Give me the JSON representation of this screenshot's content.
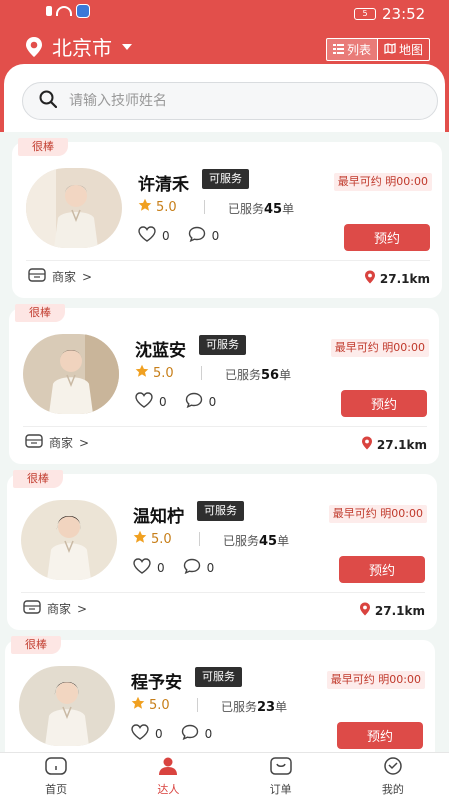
{
  "status_bar": {
    "time": "23:52",
    "battery": "5"
  },
  "header": {
    "city": "北京市",
    "view_list": "列表",
    "view_map": "地图"
  },
  "search": {
    "placeholder": "请输入技师姓名"
  },
  "labels": {
    "badge_good": "很棒",
    "service_status": "可服务",
    "earliest_prefix": "最早可约",
    "served_prefix": "已服务",
    "served_suffix": "单",
    "book": "预约",
    "merchant": "商家",
    "merchant_arrow": ">"
  },
  "therapists": [
    {
      "name": "许清禾",
      "earliest": "明00:00",
      "rating": "5.0",
      "served": "45",
      "likes": "0",
      "comments": "0",
      "distance": "27.1km"
    },
    {
      "name": "沈蓝安",
      "earliest": "明00:00",
      "rating": "5.0",
      "served": "56",
      "likes": "0",
      "comments": "0",
      "distance": "27.1km"
    },
    {
      "name": "温知柠",
      "earliest": "明00:00",
      "rating": "5.0",
      "served": "45",
      "likes": "0",
      "comments": "0",
      "distance": "27.1km"
    },
    {
      "name": "程予安",
      "earliest": "明00:00",
      "rating": "5.0",
      "served": "23",
      "likes": "0",
      "comments": "0",
      "distance": ""
    }
  ],
  "tabs": [
    {
      "label": "首页",
      "icon": "home-icon"
    },
    {
      "label": "达人",
      "icon": "person-icon"
    },
    {
      "label": "订单",
      "icon": "order-icon"
    },
    {
      "label": "我的",
      "icon": "profile-icon"
    }
  ],
  "colors": {
    "brand": "#e24f4b",
    "button": "#dd4b48",
    "badge_dark": "#2f2f2f",
    "star": "#f0a020"
  }
}
